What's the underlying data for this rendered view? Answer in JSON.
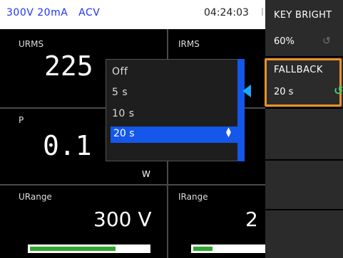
{
  "status": {
    "range": "300V 20mA   ACV",
    "time": "04:24:03",
    "separator": "l"
  },
  "tiles": {
    "urms": {
      "label": "URMS",
      "value": "225"
    },
    "irms": {
      "label": "IRMS",
      "value": ""
    },
    "p": {
      "label": "P",
      "value": "0.1",
      "unit": "W"
    },
    "p2": {
      "value": ""
    },
    "urange": {
      "label": "URange",
      "value": "300 V",
      "level": 0.72
    },
    "irange": {
      "label": "IRange",
      "value": "2",
      "level": 0.28
    }
  },
  "dropdown": {
    "options": [
      "Off",
      "5 s",
      "10 s",
      "20 s"
    ],
    "selected": "20 s",
    "spinner_up": "▲",
    "spinner_down": "▼"
  },
  "panel": {
    "key_bright_title": "KEY BRIGHT",
    "key_bright_value": "60%",
    "fallback_title": "FALLBACK",
    "fallback_value": "20 s",
    "knob_icon": "rotary-knob-icon"
  },
  "colors": {
    "accent_blue": "#1457ea",
    "pointer_blue": "#1aa8ff",
    "highlight_orange": "#e9912a",
    "knob_green": "#3fcf6e",
    "bar_green": "#2ea62e"
  }
}
